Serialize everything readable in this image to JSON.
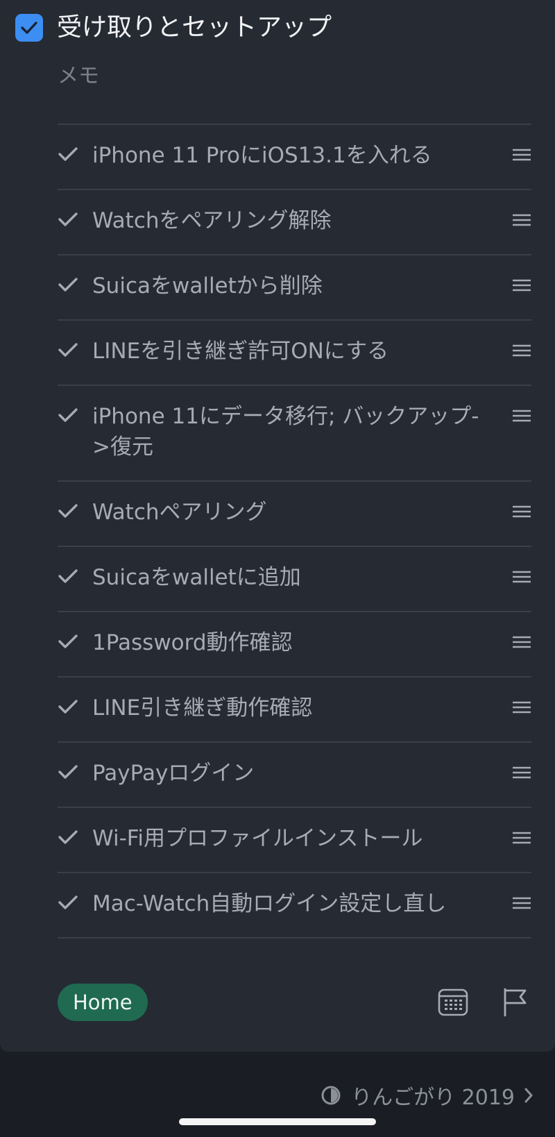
{
  "task": {
    "title": "受け取りとセットアップ",
    "completed": true,
    "memo_placeholder": "メモ"
  },
  "checklist": [
    {
      "label": "iPhone 11 ProにiOS13.1を入れる",
      "checked": true
    },
    {
      "label": "Watchをペアリング解除",
      "checked": true
    },
    {
      "label": "Suicaをwalletから削除",
      "checked": true
    },
    {
      "label": "LINEを引き継ぎ許可ONにする",
      "checked": true
    },
    {
      "label": "iPhone 11にデータ移行; バックアップ->復元",
      "checked": true
    },
    {
      "label": "Watchペアリング",
      "checked": true
    },
    {
      "label": "Suicaをwalletに追加",
      "checked": true
    },
    {
      "label": "1Password動作確認",
      "checked": true
    },
    {
      "label": "LINE引き継ぎ動作確認",
      "checked": true
    },
    {
      "label": "PayPayログイン",
      "checked": true
    },
    {
      "label": "Wi-Fi用プロファイルインストール",
      "checked": true
    },
    {
      "label": "Mac-Watch自動ログイン設定し直し",
      "checked": true
    }
  ],
  "footer": {
    "tag": "Home",
    "calendar_icon": "calendar-icon",
    "flag_icon": "flag-icon"
  },
  "list_link": {
    "name": "りんごがり 2019",
    "icon": "half-circle-icon"
  },
  "colors": {
    "accent": "#3d8ef3",
    "tag_bg": "#1f6a50",
    "card_bg": "#262a33",
    "page_bg": "#1a1d23"
  }
}
